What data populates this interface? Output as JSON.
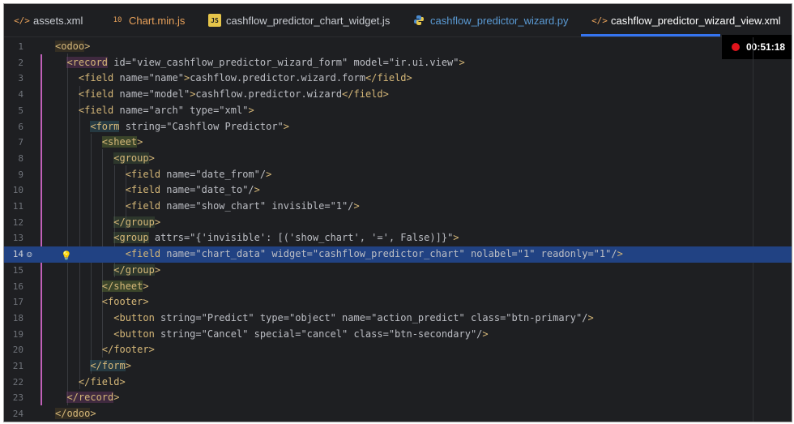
{
  "tabs": [
    {
      "label": "assets.xml",
      "icon": "xml-icon",
      "icon_glyph": "</>",
      "icon_color": "#e8a15a",
      "color": "#c9ccd2"
    },
    {
      "label": "Chart.min.js",
      "icon": "js-min-icon",
      "icon_glyph": "10",
      "icon_color": "#e8a15a",
      "color": "#e8a15a"
    },
    {
      "label": "cashflow_predictor_chart_widget.js",
      "icon": "js-icon",
      "icon_glyph": "JS",
      "icon_color": "#e6c54a",
      "color": "#c9ccd2"
    },
    {
      "label": "cashflow_predictor_wizard.py",
      "icon": "python-icon",
      "icon_glyph": "Py",
      "icon_color": "#5b9bd5",
      "color": "#5b9bd5"
    },
    {
      "label": "cashflow_predictor_wizard_view.xml",
      "icon": "xml-icon",
      "icon_glyph": "</>",
      "icon_color": "#e8a15a",
      "color": "#ffffff"
    }
  ],
  "recording": {
    "time": "00:51:18"
  },
  "editor": {
    "current_line": 14,
    "lines": [
      {
        "n": "1",
        "text": "<odoo>"
      },
      {
        "n": "2",
        "text": "  <record id=\"view_cashflow_predictor_wizard_form\" model=\"ir.ui.view\">"
      },
      {
        "n": "3",
        "text": "    <field name=\"name\">cashflow.predictor.wizard.form</field>"
      },
      {
        "n": "4",
        "text": "    <field name=\"model\">cashflow.predictor.wizard</field>"
      },
      {
        "n": "5",
        "text": "    <field name=\"arch\" type=\"xml\">"
      },
      {
        "n": "6",
        "text": "      <form string=\"Cashflow Predictor\">"
      },
      {
        "n": "7",
        "text": "        <sheet>"
      },
      {
        "n": "8",
        "text": "          <group>"
      },
      {
        "n": "9",
        "text": "            <field name=\"date_from\"/>"
      },
      {
        "n": "10",
        "text": "            <field name=\"date_to\"/>"
      },
      {
        "n": "11",
        "text": "            <field name=\"show_chart\" invisible=\"1\"/>"
      },
      {
        "n": "12",
        "text": "          </group>"
      },
      {
        "n": "13",
        "text": "          <group attrs=\"{'invisible': [('show_chart', '=', False)]}\">"
      },
      {
        "n": "14",
        "text": "            <field name=\"chart_data\" widget=\"cashflow_predictor_chart\" nolabel=\"1\" readonly=\"1\"/>"
      },
      {
        "n": "15",
        "text": "          </group>"
      },
      {
        "n": "16",
        "text": "        </sheet>"
      },
      {
        "n": "17",
        "text": "        <footer>"
      },
      {
        "n": "18",
        "text": "          <button string=\"Predict\" type=\"object\" name=\"action_predict\" class=\"btn-primary\"/>"
      },
      {
        "n": "19",
        "text": "          <button string=\"Cancel\" special=\"cancel\" class=\"btn-secondary\"/>"
      },
      {
        "n": "20",
        "text": "        </footer>"
      },
      {
        "n": "21",
        "text": "      </form>"
      },
      {
        "n": "22",
        "text": "    </field>"
      },
      {
        "n": "23",
        "text": "  </record>"
      },
      {
        "n": "24",
        "text": "</odoo>"
      }
    ]
  },
  "colors": {
    "tag": "#d5b778",
    "attr": "#bababa",
    "value": "#6aab73",
    "text": "#bcbec4",
    "selection": "#214283",
    "tab_underline": "#3574f0",
    "record_dot": "#e0141c"
  }
}
